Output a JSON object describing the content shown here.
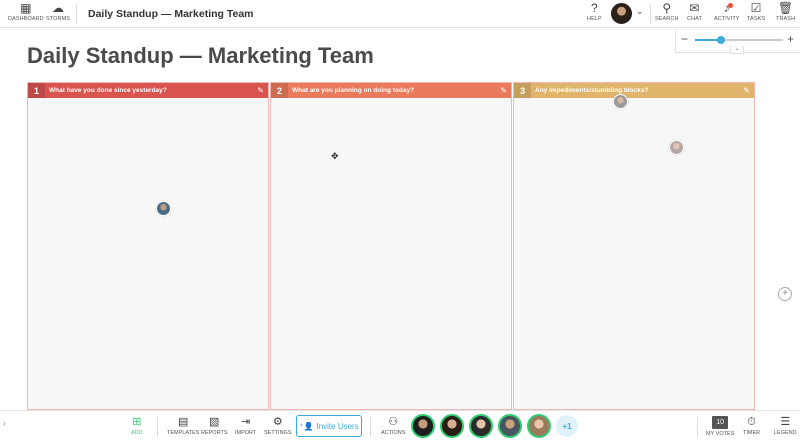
{
  "topbar": {
    "dashboard_label": "DASHBOARD",
    "storms_label": "STORMS",
    "board_title": "Daily Standup — Marketing Team",
    "help_label": "HELP",
    "search_label": "SEARCH",
    "chat_label": "CHAT",
    "activity_label": "ACTIVITY",
    "tasks_label": "TASKS",
    "trash_label": "TRASH"
  },
  "zoom": {
    "level": 0.3
  },
  "page": {
    "title": "Daily Standup — Marketing Team"
  },
  "columns": [
    {
      "number": "1",
      "question": "What have you done since yesterday?",
      "color": "#d9534f"
    },
    {
      "number": "2",
      "question": "What are you planning on doing today?",
      "color": "#ea7a5c"
    },
    {
      "number": "3",
      "question": "Any impediments/stumbling blocks?",
      "color": "#e0b46a"
    }
  ],
  "bottombar": {
    "add_label": "ADD",
    "templates_label": "TEMPLATES",
    "reports_label": "REPORTS",
    "import_label": "IMPORT",
    "settings_label": "SETTINGS",
    "invite_label": "Invite Users",
    "actions_label": "ACTIONS",
    "more_members": "+1",
    "votes_count": "10",
    "votes_label": "MY VOTES",
    "timer_label": "TIMER",
    "legend_label": "LEGEND"
  },
  "colors": {
    "accent": "#3fa9d7",
    "add_green": "#2ecc71"
  }
}
